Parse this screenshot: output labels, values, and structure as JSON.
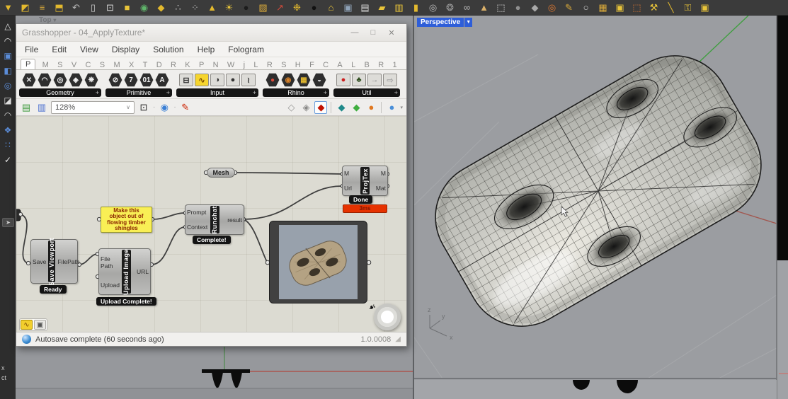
{
  "colors": {
    "accent_blue": "#2e5ed8",
    "panel_yellow": "#f9ef55",
    "runtime_red": "#e63200",
    "canvas_bg": "#dcdbd2",
    "viewport_gray": "#9a9ca0",
    "toolbar_dark": "#3b3b3b"
  },
  "rhino_top_toolbar": {
    "icons": [
      {
        "n": "filter-icon",
        "g": "▼",
        "c": "#e3b92e"
      },
      {
        "n": "shade-toggle-icon",
        "g": "◩",
        "c": "#e3b92e"
      },
      {
        "n": "layer-list-icon",
        "g": "≡",
        "c": "#d9a93a"
      },
      {
        "n": "export-box-icon",
        "g": "⬒",
        "c": "#e3b92e"
      },
      {
        "n": "undo-icon",
        "g": "↶",
        "c": "#b9b9b9"
      },
      {
        "n": "clipboard-icon",
        "g": "▯",
        "c": "#c6c6c6"
      },
      {
        "n": "numbered-box-icon",
        "g": "⊡",
        "c": "#d9d9d9"
      },
      {
        "n": "box-icon",
        "g": "■",
        "c": "#e8c43a"
      },
      {
        "n": "color-wheel-icon",
        "g": "◉",
        "c": "#5fb46a"
      },
      {
        "n": "surface-icon",
        "g": "◆",
        "c": "#e3b92e"
      },
      {
        "n": "point-cloud-icon",
        "g": "∴",
        "c": "#cfcfcf"
      },
      {
        "n": "scatter-icon",
        "g": "⁘",
        "c": "#bdbdbd"
      },
      {
        "n": "cone-sphere-icon",
        "g": "▲",
        "c": "#e3b92e"
      },
      {
        "n": "spheres-icon",
        "g": "☀",
        "c": "#e8c43a"
      },
      {
        "n": "dark-sphere-icon",
        "g": "●",
        "c": "#1c1c1c"
      },
      {
        "n": "hatch-icon",
        "g": "▨",
        "c": "#d9a93a"
      },
      {
        "n": "gumball-icon",
        "g": "↗",
        "c": "#d04a3a"
      },
      {
        "n": "ball-trio-icon",
        "g": "❉",
        "c": "#e3b92e"
      },
      {
        "n": "black-ball-icon",
        "g": "●",
        "c": "#111111"
      },
      {
        "n": "book-icon",
        "g": "⌂",
        "c": "#e8c43a"
      },
      {
        "n": "camera-robot-icon",
        "g": "▣",
        "c": "#8fa3b8"
      },
      {
        "n": "lock-note-icon",
        "g": "▤",
        "c": "#d9d9d9"
      },
      {
        "n": "plane-icon",
        "g": "▰",
        "c": "#e8c43a"
      },
      {
        "n": "column-icon",
        "g": "▥",
        "c": "#e8c43a"
      },
      {
        "n": "barrel-icon",
        "g": "▮",
        "c": "#e3b92e"
      },
      {
        "n": "spiral-icon",
        "g": "◎",
        "c": "#bdbdbd"
      },
      {
        "n": "swirl-icon",
        "g": "❂",
        "c": "#9d9d9d"
      },
      {
        "n": "chain-icon",
        "g": "∞",
        "c": "#b9b9b9"
      },
      {
        "n": "sand-cone-icon",
        "g": "▲",
        "c": "#d9b06a"
      },
      {
        "n": "selection-rect-icon",
        "g": "⬚",
        "c": "#e8e8e8"
      },
      {
        "n": "gray-sphere-icon",
        "g": "●",
        "c": "#8f8f8f"
      },
      {
        "n": "gray-cube-icon",
        "g": "◆",
        "c": "#a9a9a9"
      },
      {
        "n": "target-icon",
        "g": "◎",
        "c": "#e07830"
      },
      {
        "n": "brush-icon",
        "g": "✎",
        "c": "#d9a93a"
      },
      {
        "n": "magnifier-icon",
        "g": "○",
        "c": "#cfcfcf"
      },
      {
        "n": "grid-fence-icon",
        "g": "▦",
        "c": "#d9a93a"
      },
      {
        "n": "gold-box-icon",
        "g": "▣",
        "c": "#e8c43a"
      },
      {
        "n": "frame-box-icon",
        "g": "⬚",
        "c": "#e07830"
      },
      {
        "n": "wrench-icon",
        "g": "⚒",
        "c": "#e8c43a"
      },
      {
        "n": "knife-icon",
        "g": "╲",
        "c": "#e3b92e"
      },
      {
        "n": "keys-icon",
        "g": "⚿",
        "c": "#e8c43a"
      },
      {
        "n": "tool-box-icon",
        "g": "▣",
        "c": "#e8c43a"
      }
    ]
  },
  "rhino_left_toolbar": {
    "icons": [
      {
        "n": "polyline-icon",
        "g": "△",
        "c": "#e8e8e8"
      },
      {
        "n": "curve-node-icon",
        "g": "◠",
        "c": "#e8e8e8"
      },
      {
        "n": "control-points-icon",
        "g": "▣",
        "c": "#5b8dd9"
      },
      {
        "n": "surface-blue-icon",
        "g": "◧",
        "c": "#5b8dd9"
      },
      {
        "n": "ellipse-icon",
        "g": "◎",
        "c": "#5b8dd9"
      },
      {
        "n": "solid-icon",
        "g": "◪",
        "c": "#dddddd"
      },
      {
        "n": "arc-icon",
        "g": "◠",
        "c": "#cfcfcf"
      },
      {
        "n": "move-squares-icon",
        "g": "❖",
        "c": "#5b8dd9"
      },
      {
        "n": "point-grid-icon",
        "g": "∷",
        "c": "#5b8dd9"
      },
      {
        "n": "check-icon",
        "g": "✓",
        "c": "#efefef"
      }
    ],
    "clipped_text_1": "x",
    "clipped_text_2": "ct"
  },
  "rhino_viewports": {
    "top_tab": "Top",
    "top_tab_caret": "▾",
    "perspective_tab": "Perspective",
    "perspective_caret": "▼",
    "axis_gizmo": {
      "z": "z",
      "y": "y",
      "x": "x"
    }
  },
  "grasshopper": {
    "title": "Grasshopper - 04_ApplyTexture*",
    "window_buttons": {
      "minimize": "—",
      "maximize": "□",
      "close": "✕"
    },
    "menu": [
      "File",
      "Edit",
      "View",
      "Display",
      "Solution",
      "Help",
      "Fologram"
    ],
    "doc_name": "04_ApplyTexture",
    "tab_letters": [
      {
        "g": "P",
        "cls": "active"
      },
      "M",
      "S",
      "V",
      "C",
      "S",
      "M",
      "X",
      "T",
      "D",
      "R",
      "K",
      "P",
      "N",
      "W",
      "j",
      "L",
      "R",
      "S",
      "H",
      "F",
      "C",
      "A",
      "L",
      "B",
      "R",
      "1"
    ],
    "component_groups": [
      {
        "label": "Geometry",
        "plus": "+",
        "icons": [
          {
            "n": "geo-icon-1",
            "g": "✕"
          },
          {
            "n": "geo-icon-2",
            "g": "◠"
          },
          {
            "n": "geo-icon-3",
            "g": "◎"
          },
          {
            "n": "geo-icon-4",
            "g": "◈"
          },
          {
            "n": "geo-icon-5",
            "g": "❋"
          }
        ]
      },
      {
        "label": "Primitive",
        "plus": "+",
        "icons": [
          {
            "n": "prim-icon-1",
            "g": "⊘"
          },
          {
            "n": "prim-icon-2",
            "g": "7"
          },
          {
            "n": "prim-icon-3",
            "g": "01"
          },
          {
            "n": "prim-icon-4",
            "g": "A"
          }
        ]
      },
      {
        "label": "Input",
        "plus": "+",
        "icons": [
          {
            "n": "slider-icon",
            "g": "⊟",
            "cls": "sq"
          },
          {
            "n": "graph-mapper-icon",
            "g": "∿",
            "cls": "sq",
            "b": "#f6d52e",
            "c": "#7a4a00"
          },
          {
            "n": "toggle-icon",
            "g": "◑",
            "cls": "sq"
          },
          {
            "n": "button-icon",
            "g": "●",
            "cls": "sq"
          },
          {
            "n": "curve-input-icon",
            "g": "≀",
            "cls": "sq"
          }
        ]
      },
      {
        "label": "Rhino",
        "plus": "+",
        "icons": [
          {
            "n": "rhino-sphere-icon",
            "g": "●",
            "c": "#d94a3a"
          },
          {
            "n": "shell-icon",
            "g": "◉",
            "c": "#d9832a"
          },
          {
            "n": "honeycomb-icon",
            "g": "▦",
            "c": "#e3b92e"
          },
          {
            "n": "striped-sphere-icon",
            "g": "◒",
            "c": "#cfcfcf"
          }
        ]
      },
      {
        "label": "Util",
        "plus": "+",
        "icons": [
          {
            "n": "cherry-icon",
            "g": "●",
            "c": "#cc1f1f",
            "cls": "sq"
          },
          {
            "n": "tree-icon",
            "g": "♣",
            "c": "#2e4d1f",
            "cls": "sq"
          },
          {
            "n": "arrow-solid-icon",
            "g": "→",
            "c": "#8a8a8a",
            "cls": "sq"
          },
          {
            "n": "arrow-outline-icon",
            "g": "⇨",
            "c": "#aaaaaa",
            "cls": "sq"
          }
        ]
      }
    ],
    "view_toolbar": {
      "zoom_value": "128%",
      "caret": "∨"
    },
    "canvas": {
      "components": {
        "mesh_param": {
          "label": "Mesh"
        },
        "save_viewport": {
          "name": "Save Viewport",
          "inputs": [
            "Save"
          ],
          "outputs": [
            "FilePath"
          ],
          "status": "Ready"
        },
        "upload_image": {
          "name": "Upload Image",
          "inputs": [
            "File Path",
            "Upload"
          ],
          "outputs": [
            "URL"
          ],
          "status": "Upload Complete!"
        },
        "note_panel": {
          "line1": "Make this",
          "line2": "object out of",
          "line3": "flowing timber",
          "line4": "shingles"
        },
        "runchat": {
          "name": "Runchat",
          "inputs": [
            "Prompt",
            "Context"
          ],
          "outputs": [
            "result"
          ],
          "status": "Complete!"
        },
        "projtex": {
          "name": "ProjTex",
          "inputs": [
            "M",
            "Url"
          ],
          "outputs": [
            "M",
            "Mat"
          ],
          "status": "Done",
          "runtime": "3ms"
        }
      }
    },
    "status_bar": {
      "message": "Autosave complete (60 seconds ago)",
      "version": "1.0.0008"
    }
  }
}
